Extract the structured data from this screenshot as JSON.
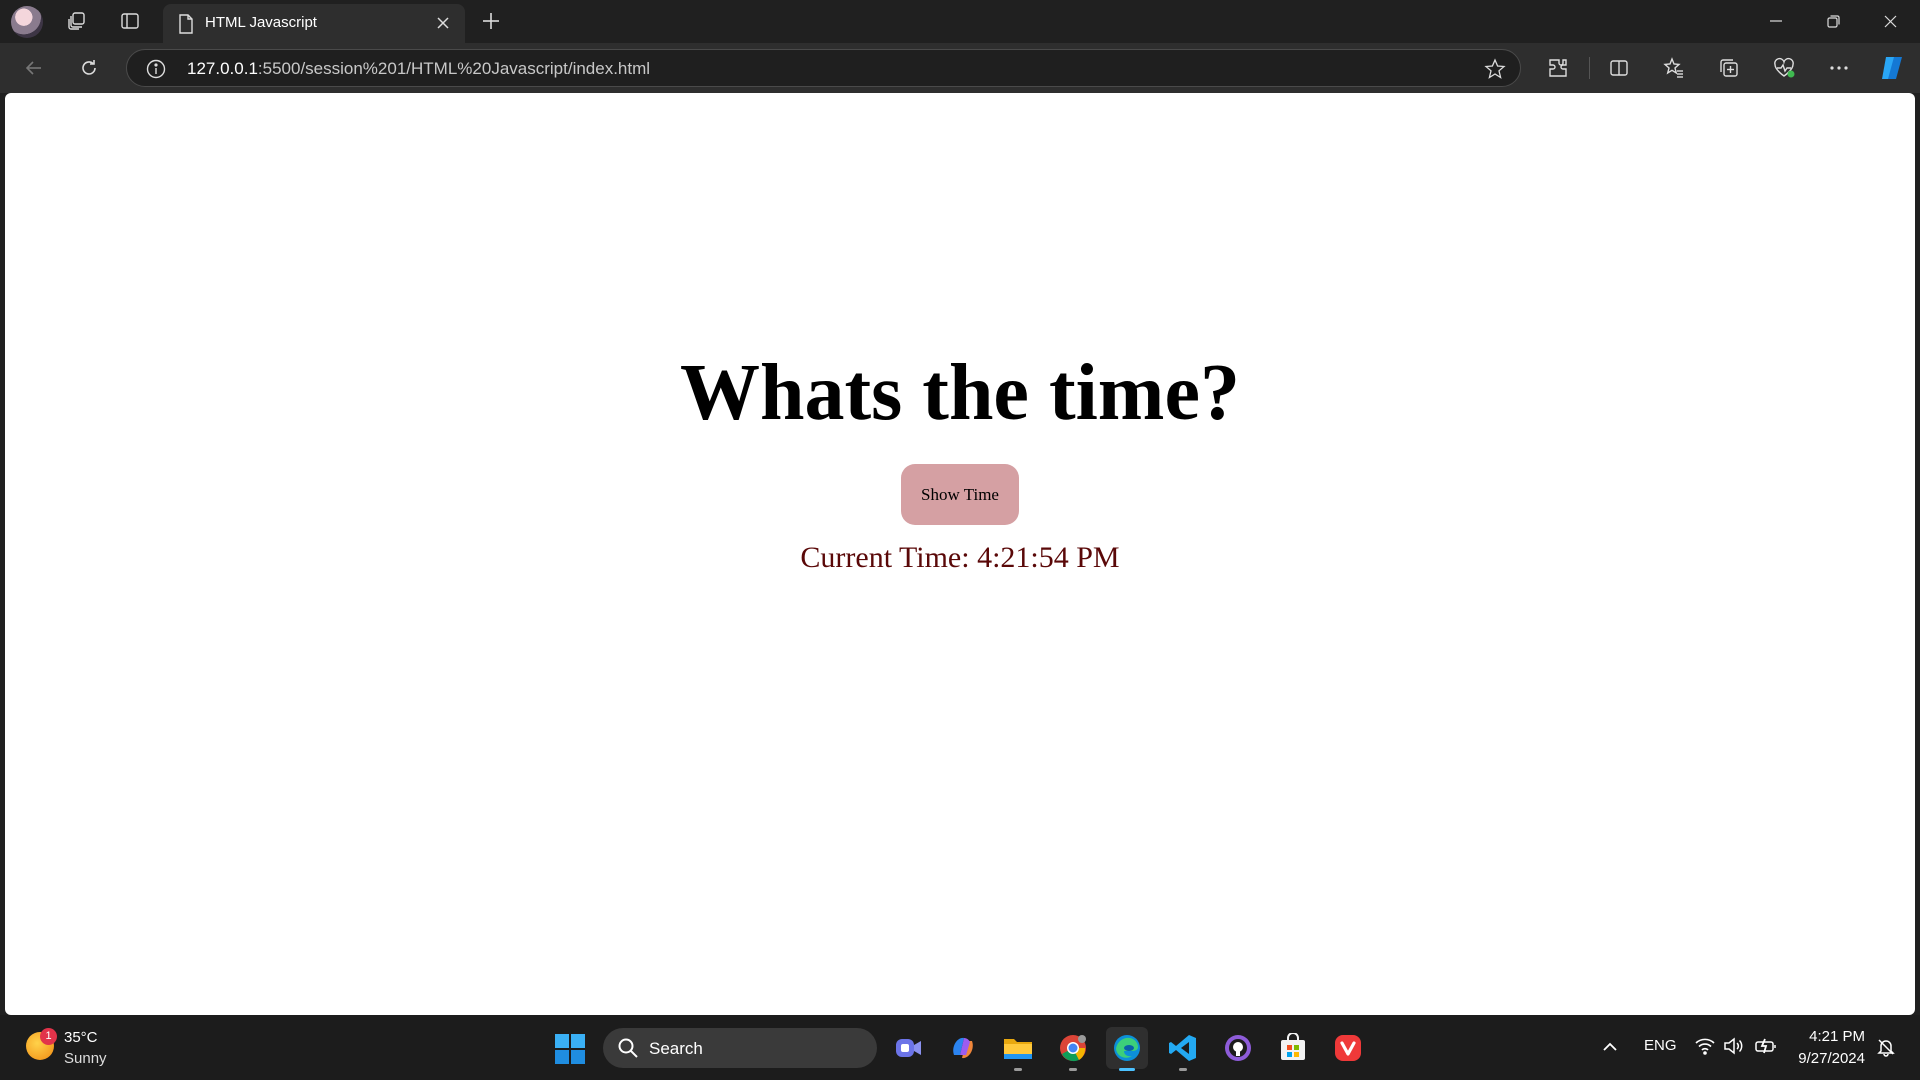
{
  "browser": {
    "tab": {
      "title": "HTML Javascript"
    },
    "address": {
      "host": "127.0.0.1",
      "path": ":5500/session%201/HTML%20Javascript/index.html"
    }
  },
  "page": {
    "heading": "Whats the time?",
    "button_label": "Show Time",
    "time_text": "Current Time: 4:21:54 PM",
    "colors": {
      "button_bg": "#d5a0a3",
      "time_text": "#5a0808"
    }
  },
  "taskbar": {
    "weather": {
      "badge": "1",
      "temp": "35°C",
      "condition": "Sunny"
    },
    "search_placeholder": "Search",
    "apps": [
      "meet-now",
      "copilot",
      "file-explorer",
      "chrome",
      "edge",
      "vscode",
      "github-desktop",
      "microsoft-store",
      "vivaldi"
    ],
    "language": "ENG",
    "clock": {
      "time": "4:21 PM",
      "date": "9/27/2024"
    }
  }
}
